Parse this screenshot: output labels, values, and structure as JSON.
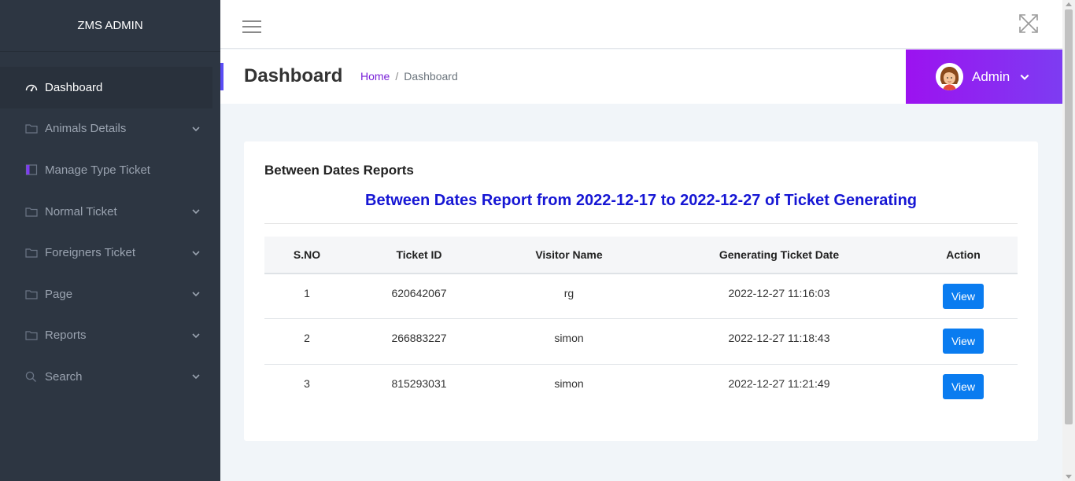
{
  "brand": "ZMS ADMIN",
  "sidebar": {
    "items": [
      {
        "label": "Dashboard",
        "icon": "dashboard-gauge-icon",
        "active": true
      },
      {
        "label": "Animals Details",
        "icon": "folder-icon",
        "has_submenu": true
      },
      {
        "label": "Manage Type Ticket",
        "icon": "book-icon"
      },
      {
        "label": "Normal Ticket",
        "icon": "folder-icon",
        "has_submenu": true
      },
      {
        "label": "Foreigners Ticket",
        "icon": "folder-icon",
        "has_submenu": true
      },
      {
        "label": "Page",
        "icon": "folder-icon",
        "has_submenu": true
      },
      {
        "label": "Reports",
        "icon": "folder-icon",
        "has_submenu": true
      },
      {
        "label": "Search",
        "icon": "search-icon",
        "has_submenu": true
      }
    ]
  },
  "header": {
    "page_title": "Dashboard",
    "breadcrumb": {
      "home": "Home",
      "separator": "/",
      "current": "Dashboard"
    },
    "user": {
      "name": "Admin"
    }
  },
  "card": {
    "title": "Between Dates Reports",
    "report_heading": "Between Dates Report from 2022-12-17 to 2022-12-27 of Ticket Generating",
    "table": {
      "columns": [
        "S.NO",
        "Ticket ID",
        "Visitor Name",
        "Generating Ticket Date",
        "Action"
      ],
      "rows": [
        {
          "sno": "1",
          "ticket_id": "620642067",
          "visitor": "rg",
          "date": "2022-12-27 11:16:03",
          "action": "View"
        },
        {
          "sno": "2",
          "ticket_id": "266883227",
          "visitor": "simon",
          "date": "2022-12-27 11:18:43",
          "action": "View"
        },
        {
          "sno": "3",
          "ticket_id": "815293031",
          "visitor": "simon",
          "date": "2022-12-27 11:21:49",
          "action": "View"
        }
      ]
    }
  },
  "colors": {
    "sidebar_bg": "#2d3642",
    "accent_purple": "#9c12f0",
    "link_purple": "#7a22d8",
    "report_heading_blue": "#1616d4",
    "view_button_blue": "#0a7cf0"
  }
}
